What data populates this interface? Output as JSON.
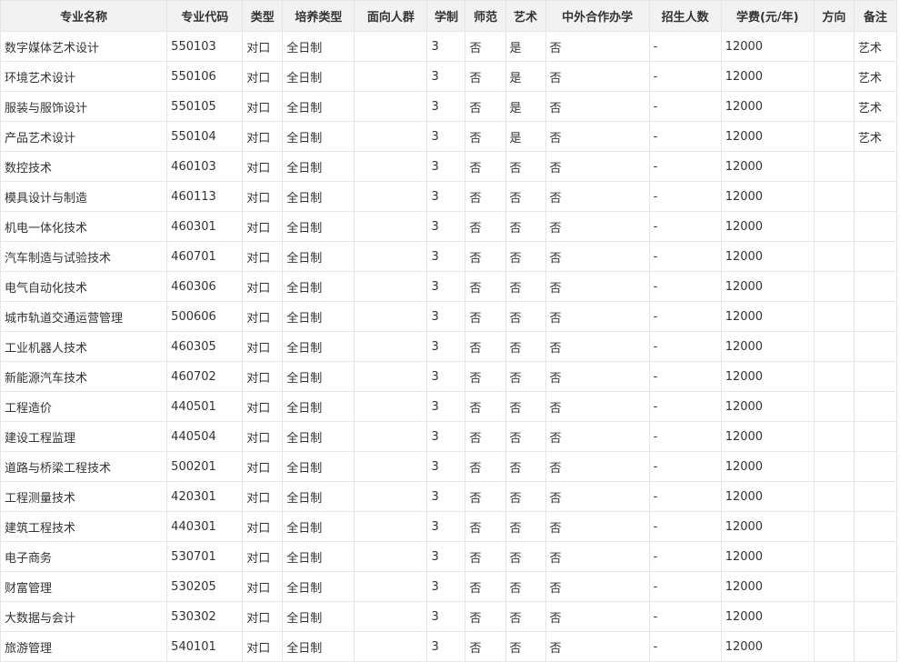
{
  "table": {
    "headers": [
      "专业名称",
      "专业代码",
      "类型",
      "培养类型",
      "面向人群",
      "学制",
      "师范",
      "艺术",
      "中外合作办学",
      "招生人数",
      "学费(元/年)",
      "方向",
      "备注"
    ],
    "rows": [
      [
        "数字媒体艺术设计",
        "550103",
        "对口",
        "全日制",
        "",
        "3",
        "否",
        "是",
        "否",
        "-",
        "12000",
        "",
        "艺术"
      ],
      [
        "环境艺术设计",
        "550106",
        "对口",
        "全日制",
        "",
        "3",
        "否",
        "是",
        "否",
        "-",
        "12000",
        "",
        "艺术"
      ],
      [
        "服装与服饰设计",
        "550105",
        "对口",
        "全日制",
        "",
        "3",
        "否",
        "是",
        "否",
        "-",
        "12000",
        "",
        "艺术"
      ],
      [
        "产品艺术设计",
        "550104",
        "对口",
        "全日制",
        "",
        "3",
        "否",
        "是",
        "否",
        "-",
        "12000",
        "",
        "艺术"
      ],
      [
        "数控技术",
        "460103",
        "对口",
        "全日制",
        "",
        "3",
        "否",
        "否",
        "否",
        "-",
        "12000",
        "",
        ""
      ],
      [
        "模具设计与制造",
        "460113",
        "对口",
        "全日制",
        "",
        "3",
        "否",
        "否",
        "否",
        "-",
        "12000",
        "",
        ""
      ],
      [
        "机电一体化技术",
        "460301",
        "对口",
        "全日制",
        "",
        "3",
        "否",
        "否",
        "否",
        "-",
        "12000",
        "",
        ""
      ],
      [
        "汽车制造与试验技术",
        "460701",
        "对口",
        "全日制",
        "",
        "3",
        "否",
        "否",
        "否",
        "-",
        "12000",
        "",
        ""
      ],
      [
        "电气自动化技术",
        "460306",
        "对口",
        "全日制",
        "",
        "3",
        "否",
        "否",
        "否",
        "-",
        "12000",
        "",
        ""
      ],
      [
        "城市轨道交通运营管理",
        "500606",
        "对口",
        "全日制",
        "",
        "3",
        "否",
        "否",
        "否",
        "-",
        "12000",
        "",
        ""
      ],
      [
        "工业机器人技术",
        "460305",
        "对口",
        "全日制",
        "",
        "3",
        "否",
        "否",
        "否",
        "-",
        "12000",
        "",
        ""
      ],
      [
        "新能源汽车技术",
        "460702",
        "对口",
        "全日制",
        "",
        "3",
        "否",
        "否",
        "否",
        "-",
        "12000",
        "",
        ""
      ],
      [
        "工程造价",
        "440501",
        "对口",
        "全日制",
        "",
        "3",
        "否",
        "否",
        "否",
        "-",
        "12000",
        "",
        ""
      ],
      [
        "建设工程监理",
        "440504",
        "对口",
        "全日制",
        "",
        "3",
        "否",
        "否",
        "否",
        "-",
        "12000",
        "",
        ""
      ],
      [
        "道路与桥梁工程技术",
        "500201",
        "对口",
        "全日制",
        "",
        "3",
        "否",
        "否",
        "否",
        "-",
        "12000",
        "",
        ""
      ],
      [
        "工程测量技术",
        "420301",
        "对口",
        "全日制",
        "",
        "3",
        "否",
        "否",
        "否",
        "-",
        "12000",
        "",
        ""
      ],
      [
        "建筑工程技术",
        "440301",
        "对口",
        "全日制",
        "",
        "3",
        "否",
        "否",
        "否",
        "-",
        "12000",
        "",
        ""
      ],
      [
        "电子商务",
        "530701",
        "对口",
        "全日制",
        "",
        "3",
        "否",
        "否",
        "否",
        "-",
        "12000",
        "",
        ""
      ],
      [
        "财富管理",
        "530205",
        "对口",
        "全日制",
        "",
        "3",
        "否",
        "否",
        "否",
        "-",
        "12000",
        "",
        ""
      ],
      [
        "大数据与会计",
        "530302",
        "对口",
        "全日制",
        "",
        "3",
        "否",
        "否",
        "否",
        "-",
        "12000",
        "",
        ""
      ],
      [
        "旅游管理",
        "540101",
        "对口",
        "全日制",
        "",
        "3",
        "否",
        "否",
        "否",
        "-",
        "12000",
        "",
        ""
      ]
    ]
  }
}
